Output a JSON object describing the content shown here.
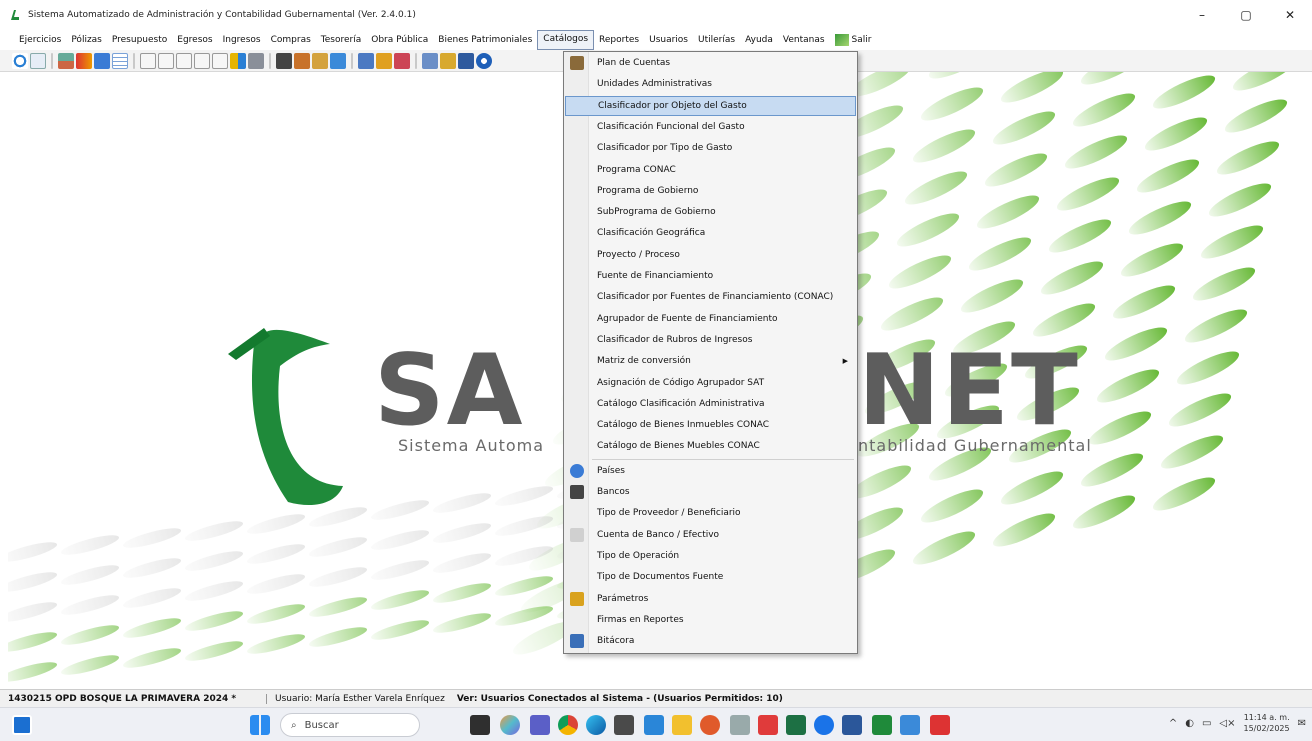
{
  "window": {
    "title": "Sistema Automatizado de Administración y Contabilidad Gubernamental  (Ver. 2.4.0.1)",
    "minimize": "–",
    "maximize": "▢",
    "close": "✕"
  },
  "menubar": {
    "items": [
      "Ejercicios",
      "Pólizas",
      "Presupuesto",
      "Egresos",
      "Ingresos",
      "Compras",
      "Tesorería",
      "Obra Pública",
      "Bienes Patrimoniales",
      "Catálogos",
      "Reportes",
      "Usuarios",
      "Utilerías",
      "Ayuda",
      "Ventanas"
    ],
    "salir": "Salir"
  },
  "logo": {
    "name": "SAACGNET",
    "tagline": "Sistema Automatizado de Administración y Contabilidad Gubernamental",
    "wordmark_left": "SA",
    "wordmark_right": "NET",
    "tagline_left": "Sistema Automa",
    "tagline_right": "ntabilidad Gubernamental"
  },
  "menu": {
    "items": [
      {
        "label": "Plan de Cuentas",
        "icon": "tree-icon"
      },
      {
        "label": "Unidades Administrativas"
      },
      {
        "label": "Clasificador por Objeto del Gasto",
        "highlighted": true
      },
      {
        "label": "Clasificación Funcional del Gasto"
      },
      {
        "label": "Clasificador por Tipo de Gasto"
      },
      {
        "label": "Programa CONAC"
      },
      {
        "label": "Programa de Gobierno"
      },
      {
        "label": "SubPrograma de Gobierno"
      },
      {
        "label": "Clasificación Geográfica"
      },
      {
        "label": "Proyecto / Proceso"
      },
      {
        "label": "Fuente de Financiamiento"
      },
      {
        "label": "Clasificador por Fuentes de Financiamiento (CONAC)"
      },
      {
        "label": "Agrupador de Fuente de Financiamiento"
      },
      {
        "label": "Clasificador de Rubros de Ingresos"
      },
      {
        "label": "Matriz de conversión",
        "submenu": true
      },
      {
        "label": "Asignación de Código Agrupador SAT"
      },
      {
        "label": "Catálogo Clasificación Administrativa"
      },
      {
        "label": "Catálogo de Bienes Inmuebles CONAC"
      },
      {
        "label": "Catálogo de Bienes Muebles CONAC"
      },
      {
        "label": "Países",
        "icon": "globe-icon"
      },
      {
        "label": "Bancos",
        "icon": "bank-icon"
      },
      {
        "label": "Tipo de Proveedor / Beneficiario"
      },
      {
        "label": "Cuenta de Banco / Efectivo",
        "icon": "account-icon"
      },
      {
        "label": "Tipo de Operación"
      },
      {
        "label": "Tipo de Documentos Fuente"
      },
      {
        "label": "Parámetros",
        "icon": "parameters-icon"
      },
      {
        "label": "Firmas en Reportes"
      },
      {
        "label": "Bitácora",
        "icon": "log-icon"
      }
    ]
  },
  "status": {
    "org": "1430215 OPD BOSQUE LA PRIMAVERA  2024  *",
    "user": "Usuario: María Esther Varela Enríquez",
    "ver": "Ver: Usuarios Conectados al Sistema - (Usuarios Permitidos: 10)"
  },
  "taskbar": {
    "search_placeholder": "Buscar",
    "time": "11:14 a. m.",
    "date": "15/02/2025"
  },
  "colors": {
    "highlight": "#c7dbf2",
    "highlight_border": "#6b97cc",
    "logo_green": "#1f8a3a",
    "logo_gray": "#5d5d5d"
  }
}
